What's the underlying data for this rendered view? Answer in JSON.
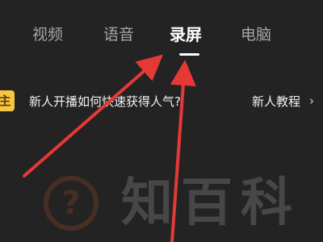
{
  "tabs": [
    {
      "label": "视频",
      "active": false
    },
    {
      "label": "语音",
      "active": false
    },
    {
      "label": "录屏",
      "active": true
    },
    {
      "label": "电脑",
      "active": false
    }
  ],
  "tip": {
    "badge": "主",
    "question": "新人开播如何快速获得人气?",
    "link_label": "新人教程",
    "chevron": "›"
  },
  "watermark": {
    "symbol": "?",
    "text": "知百科"
  },
  "colors": {
    "background": "#232323",
    "active_tab": "#ffffff",
    "inactive_tab": "#a6a6a6",
    "arrow": "#e53935",
    "badge": "#f6c543"
  }
}
